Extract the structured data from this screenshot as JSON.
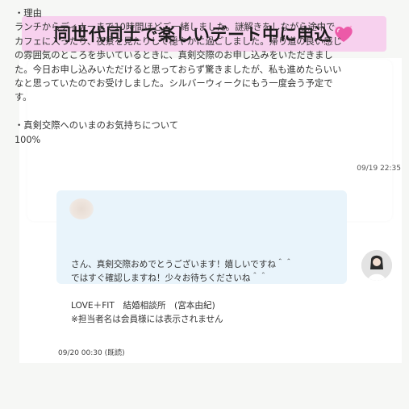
{
  "banner": {
    "title": "同世代同士で楽しいデート中に申込"
  },
  "incoming": {
    "message": "・理由\nランチからディナーまで10時間ほどご一緒しました。謎解きをしながら途中で\nカフェに入ったり、夜景を見たりして穏やかに過ごしました。帰り道の良い感じ\nの雰囲気のところを歩いているときに、真剣交際のお申し込みをいただきまし\nた。今日お申し込みいただけると思っておらず驚きましたが、私も進めたらいい\nなと思っていたのでお受けしました。シルバーウィークにもう一度会う予定で\nす。\n\n・真剣交際へのいまのお気持ちについて\n100%",
    "timestamp": "09/19 22:35"
  },
  "outgoing": {
    "message": "さん、真剣交際おめでとうございます！嬉しいですね＾＾\nではすぐ確認しますね！少々お待ちくださいね＾＾\n\nLOVE＋FIT　結婚相談所　(宮本由紀)\n※担当者名は会員様には表示されません",
    "timestamp": "09/20 00:30 (既読)"
  },
  "colors": {
    "banner_bg": "#f7d1ee",
    "outgoing_bg": "#e9f4fb",
    "heart": "#ec5aa8"
  }
}
